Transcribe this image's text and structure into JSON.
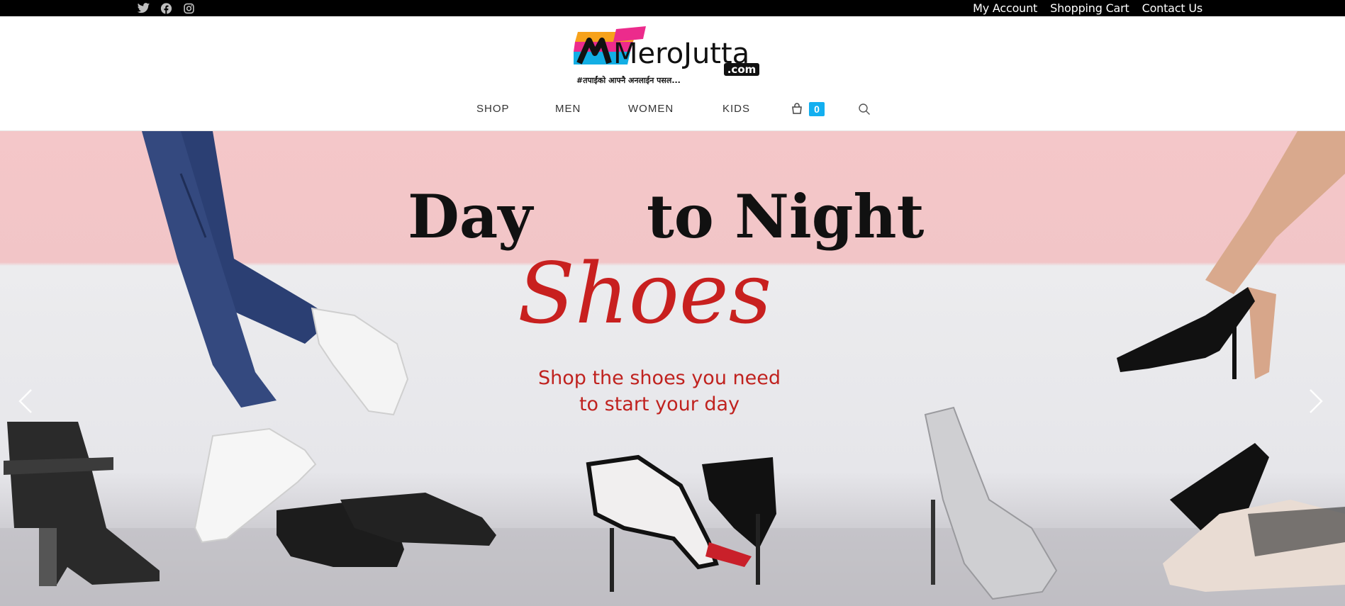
{
  "topbar": {
    "social_icons": [
      "twitter-icon",
      "facebook-icon",
      "instagram-icon"
    ],
    "links": [
      "My Account",
      "Shopping Cart",
      "Contact Us"
    ]
  },
  "header": {
    "logo": {
      "wordmark": "MeroJutta",
      "domain": ".com",
      "tagline": "#तपाईंको आफ्नै अनलाईन पसल..."
    },
    "nav": [
      "SHOP",
      "MEN",
      "WOMEN",
      "KIDS"
    ],
    "cart_count": "0",
    "icons": [
      "shopping-bag-icon",
      "search-icon"
    ]
  },
  "hero": {
    "headline_left": "Day",
    "headline_right": "to Night",
    "headline_script": "Shoes",
    "caption_line1": "Shop the shoes you need",
    "caption_line2": "to  start your day",
    "controls": [
      "chevron-left-icon",
      "chevron-right-icon"
    ]
  },
  "colors": {
    "topbar": "#000000",
    "accent": "#13aff0",
    "hero_red": "#c0221f",
    "hero_pink": "#f4c7c9"
  }
}
